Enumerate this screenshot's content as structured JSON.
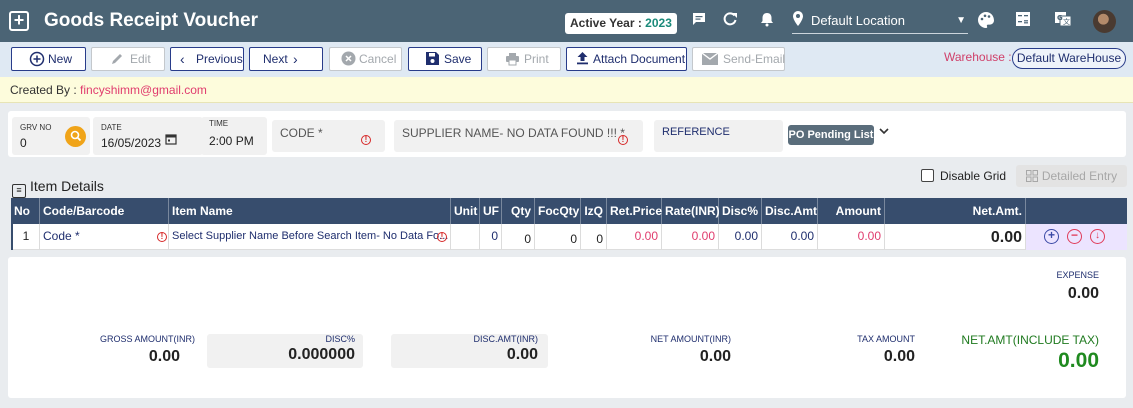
{
  "app": {
    "title": "Goods Receipt Voucher",
    "active_year_label": "Active Year :",
    "active_year_value": "2023",
    "location": "Default Location"
  },
  "toolbar": {
    "new": "New",
    "edit": "Edit",
    "previous": "Previous",
    "next": "Next",
    "cancel": "Cancel",
    "save": "Save",
    "print": "Print",
    "attach": "Attach Document",
    "send_email": "Send-Email",
    "warehouse_label": "Warehouse :",
    "warehouse_value": "Default WareHouse"
  },
  "created_by": {
    "label": "Created By :",
    "email": "fincyshimm@gmail.com"
  },
  "header": {
    "grv_no_label": "GRV NO",
    "grv_no_value": "0",
    "date_label": "DATE",
    "date_value": "16/05/2023",
    "time_label": "TIME",
    "time_value": "2:00 PM",
    "code_label": "CODE *",
    "supplier_label": "SUPPLIER NAME- NO DATA FOUND !!! *",
    "reference_label": "REFERENCE",
    "po_pending": "PO Pending List"
  },
  "items": {
    "title": "Item Details",
    "disable_grid": "Disable Grid",
    "detailed_entry": "Detailed Entry",
    "columns": [
      "No",
      "Code/Barcode",
      "Item Name",
      "Unit",
      "UF",
      "Qty",
      "FocQty",
      "IzQ",
      "Ret.Price",
      "Rate(INR)",
      "Disc%",
      "Disc.Amt",
      "Amount",
      "Net.Amt."
    ],
    "row": {
      "no": "1",
      "code": "Code *",
      "item_name": "Select Supplier Name Before Search Item- No Data Fo...",
      "unit": "",
      "uf": "0",
      "qty": "0",
      "foc_qty": "0",
      "izq": "0",
      "ret_price": "0.00",
      "rate": "0.00",
      "disc_pct": "0.00",
      "disc_amt": "0.00",
      "amount": "0.00",
      "net_amt": "0.00"
    }
  },
  "totals": {
    "expense_label": "EXPENSE",
    "expense_value": "0.00",
    "gross_label": "GROSS AMOUNT(INR)",
    "gross_value": "0.00",
    "disc_pct_label": "DISC%",
    "disc_pct_value": "0.000000",
    "disc_amt_label": "DISC.AMT(INR)",
    "disc_amt_value": "0.00",
    "net_label": "NET AMOUNT(INR)",
    "net_value": "0.00",
    "tax_label": "TAX AMOUNT",
    "tax_value": "0.00",
    "net_tax_label": "NET.AMT(INCLUDE TAX)",
    "net_tax_value": "0.00"
  },
  "colors": {
    "topbar": "#4b6475",
    "accent_navy": "#1f2e6e",
    "grid_header": "#374d6d",
    "warning_red": "#e03c6e",
    "success_green": "#1f8a1f"
  },
  "icons": [
    "add-icon",
    "chat-icon",
    "refresh-icon",
    "bell-icon",
    "location-pin-icon",
    "palette-icon",
    "calculator-icon",
    "translate-icon"
  ]
}
